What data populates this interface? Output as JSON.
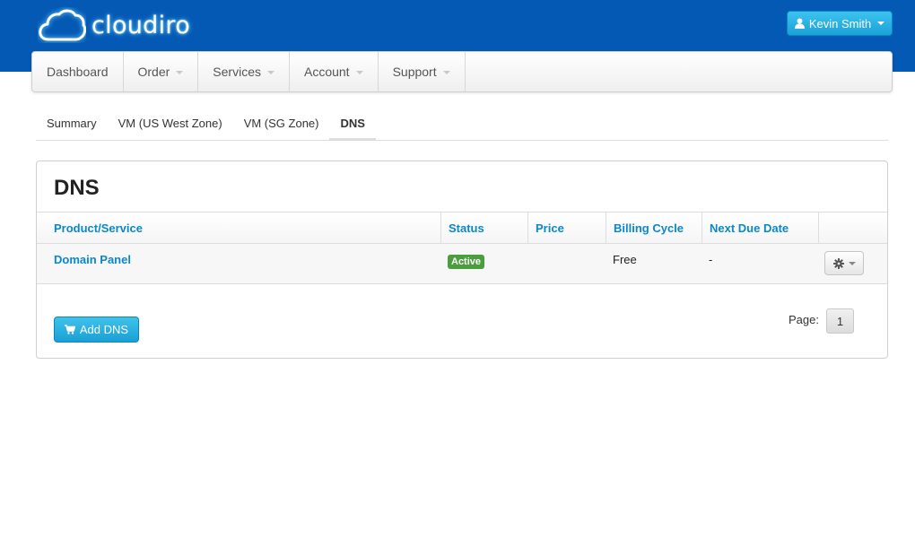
{
  "brand": {
    "name": "cloudiro"
  },
  "user_menu": {
    "label": "Kevin Smith",
    "icon": "user-icon"
  },
  "navbar": {
    "items": [
      {
        "label": "Dashboard",
        "has_dropdown": false
      },
      {
        "label": "Order",
        "has_dropdown": true
      },
      {
        "label": "Services",
        "has_dropdown": true
      },
      {
        "label": "Account",
        "has_dropdown": true
      },
      {
        "label": "Support",
        "has_dropdown": true
      }
    ]
  },
  "tabs": [
    {
      "label": "Summary",
      "active": false
    },
    {
      "label": "VM (US West Zone)",
      "active": false
    },
    {
      "label": "VM (SG Zone)",
      "active": false
    },
    {
      "label": "DNS",
      "active": true
    }
  ],
  "panel": {
    "title": "DNS",
    "columns": [
      "Product/Service",
      "Status",
      "Price",
      "Billing Cycle",
      "Next Due Date"
    ],
    "rows": [
      {
        "product": "Domain Panel",
        "status": "Active",
        "price": "",
        "billing_cycle": "Free",
        "next_due": "-"
      }
    ],
    "add_button": "Add DNS",
    "pagination": {
      "label": "Page:",
      "current": "1"
    }
  },
  "colors": {
    "header_bg": "#0459b5",
    "accent": "#0a88c8",
    "button": "#1aa2d8",
    "status_active": "#4a9e3c"
  }
}
